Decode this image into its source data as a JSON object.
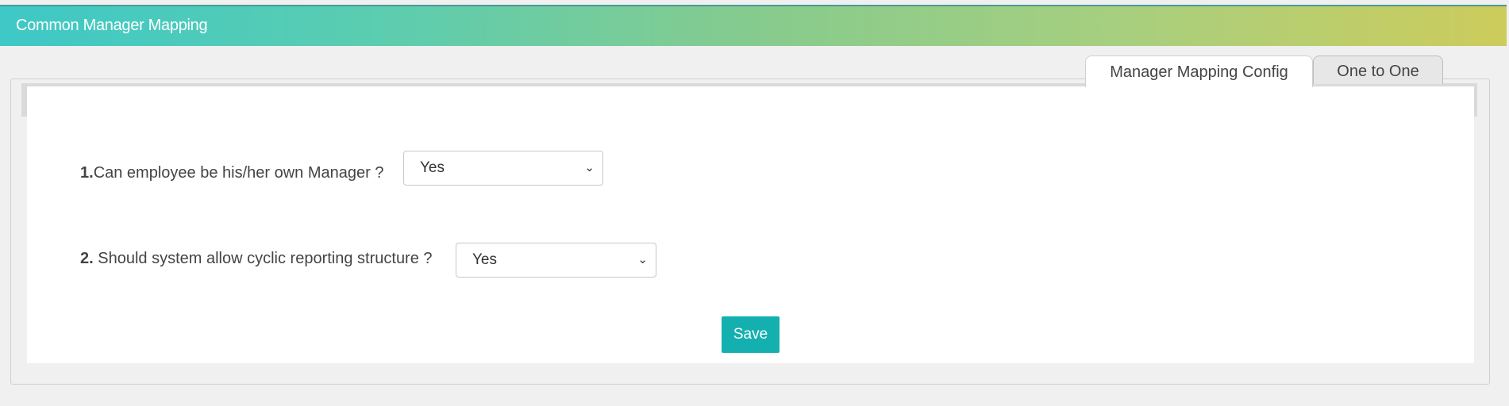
{
  "header": {
    "title": "Common Manager Mapping"
  },
  "tabs": [
    {
      "label": "Manager Mapping Config",
      "active": true
    },
    {
      "label": "One to One",
      "active": false
    }
  ],
  "form": {
    "questions": [
      {
        "number": "1.",
        "text": "Can employee be his/her own Manager ?",
        "value": "Yes"
      },
      {
        "number": "2.",
        "text": " Should system allow cyclic reporting structure ?",
        "value": "Yes"
      }
    ],
    "save_label": "Save"
  },
  "colors": {
    "header_gradient_start": "#3ec8c6",
    "header_gradient_end": "#cdcc5c",
    "save_button": "#14b0b0"
  }
}
